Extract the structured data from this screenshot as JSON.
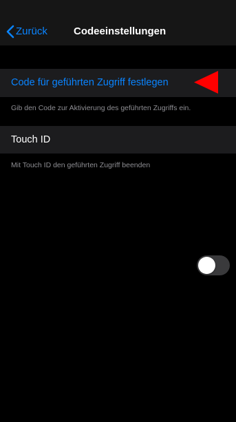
{
  "navbar": {
    "back_label": "Zurück",
    "title": "Codeeinstellungen"
  },
  "code_section": {
    "row_label": "Code für geführten Zugriff festlegen",
    "footnote": "Gib den Code zur Aktivierung des geführten Zugriffs ein."
  },
  "touch_section": {
    "row_label": "Touch ID",
    "toggle_on": false,
    "footnote": "Mit Touch ID den geführten Zugriff beenden"
  },
  "colors": {
    "accent": "#0a84ff",
    "background": "#000000",
    "row_background": "#1c1c1e",
    "annotation_arrow": "#ff0000"
  },
  "icons": {
    "back": "chevron-left-icon",
    "annotation": "red-arrow-left-icon"
  }
}
